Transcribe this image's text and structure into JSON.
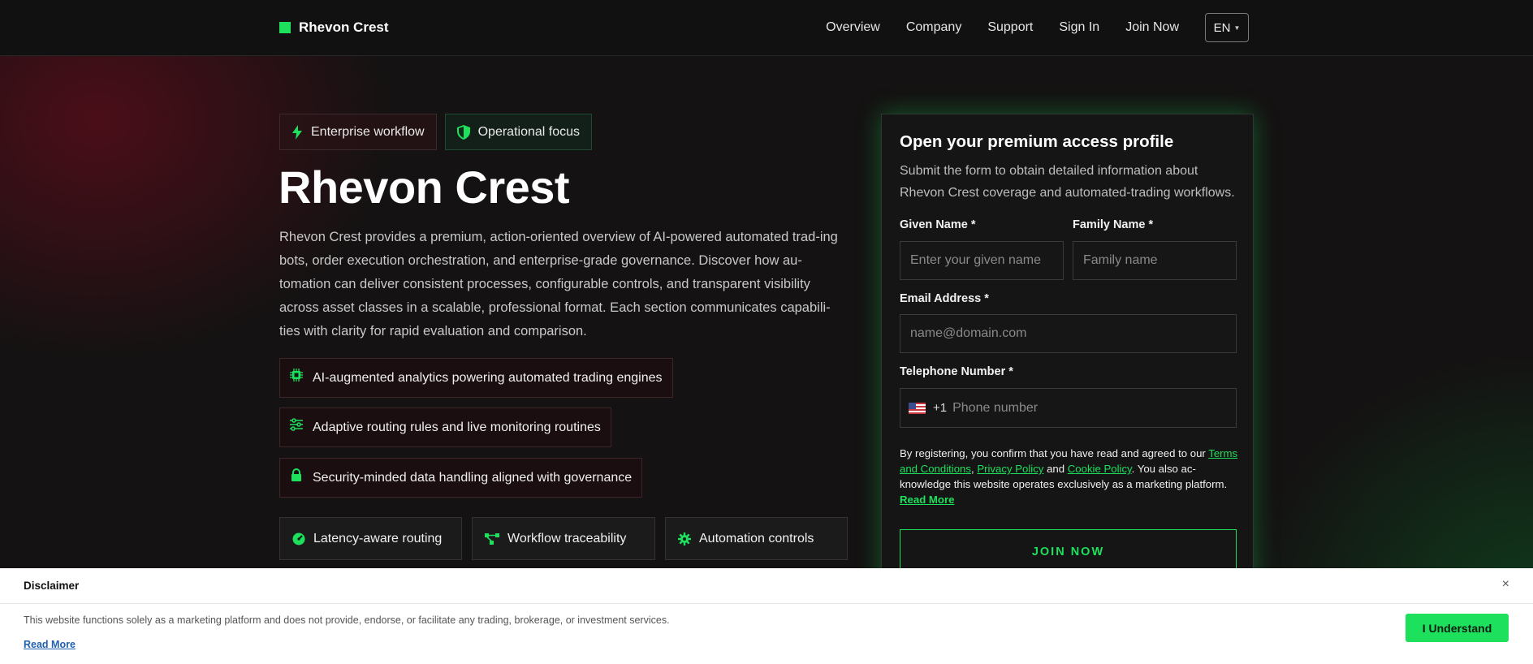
{
  "nav": {
    "brand": "Rhevon Crest",
    "links": [
      "Overview",
      "Company",
      "Support",
      "Sign In",
      "Join Now"
    ],
    "lang": "EN"
  },
  "hero": {
    "tags": [
      "Enterprise workflow",
      "Operational focus"
    ],
    "title": "Rhevon Crest",
    "description": "Rhevon Crest provides a premium, action-oriented overview of AI-powered automated trad-ing bots, order execution orchestration, and enterprise-grade governance. Discover how au-tomation can deliver consistent processes, configurable controls, and transparent visibility across asset classes in a scalable, professional format. Each section communicates capabili-ties with clarity for rapid evaluation and comparison.",
    "features": [
      "AI-augmented analytics powering automated trading engines",
      "Adaptive routing rules and live monitoring routines",
      "Security-minded data handling aligned with governance"
    ],
    "chips": [
      "Latency-aware routing",
      "Workflow traceability",
      "Automation controls"
    ]
  },
  "form": {
    "title": "Open your premium access profile",
    "subtitle": "Submit the form to obtain detailed information about Rhevon Crest coverage and automated-trading workflows.",
    "given_label": "Given Name *",
    "given_placeholder": "Enter your given name",
    "family_label": "Family Name *",
    "family_placeholder": "Family name",
    "email_label": "Email Address *",
    "email_placeholder": "name@domain.com",
    "phone_label": "Telephone Number *",
    "phone_code": "+1",
    "phone_placeholder": "Phone number",
    "legal_prefix": "By registering, you confirm that you have read and agreed to our",
    "terms": "Terms and Conditions",
    "privacy": "Privacy Policy",
    "and": "and",
    "cookie": "Cookie Policy",
    "legal_suffix": ". You also ac-knowledge this website operates exclusively as a marketing platform.",
    "read_more": "Read More",
    "submit": "JOIN NOW"
  },
  "disclaimer": {
    "title": "Disclaimer",
    "close": "×",
    "text": "This website functions solely as a marketing platform and does not provide, endorse, or facilitate any trading, brokerage, or investment services.",
    "read_more": "Read More",
    "accept": "I Understand"
  },
  "colors": {
    "accent": "#1de05c",
    "bg": "#121212",
    "card_glow": "#1de05c"
  }
}
